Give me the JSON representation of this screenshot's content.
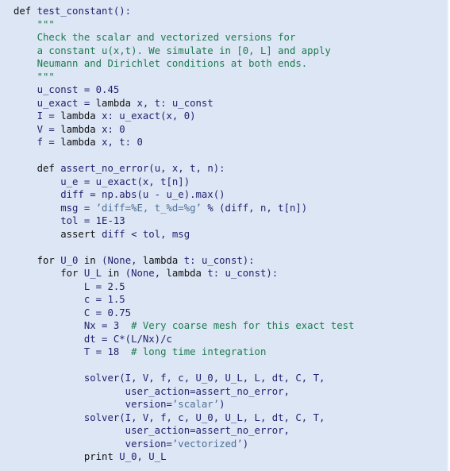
{
  "listing": {
    "language": "python",
    "colors": {
      "background": "#dce6f5",
      "keyword": "#111111",
      "identifier": "#22226e",
      "string": "#4d6f94",
      "comment": "#1e7a4e"
    },
    "lines": [
      [
        [
          "kw",
          "def "
        ],
        [
          "id",
          "test_constant():"
        ]
      ],
      [
        [
          "com",
          "    \"\"\""
        ]
      ],
      [
        [
          "com",
          "    Check the scalar and vectorized versions for"
        ]
      ],
      [
        [
          "com",
          "    a constant u(x,t). We simulate in [0, L] and apply"
        ]
      ],
      [
        [
          "com",
          "    Neumann and Dirichlet conditions at both ends."
        ]
      ],
      [
        [
          "com",
          "    \"\"\""
        ]
      ],
      [
        [
          "id",
          "    u_const = 0.45"
        ]
      ],
      [
        [
          "id",
          "    u_exact = "
        ],
        [
          "kw",
          "lambda "
        ],
        [
          "id",
          "x, t: u_const"
        ]
      ],
      [
        [
          "id",
          "    I = "
        ],
        [
          "kw",
          "lambda "
        ],
        [
          "id",
          "x: u_exact(x, 0)"
        ]
      ],
      [
        [
          "id",
          "    V = "
        ],
        [
          "kw",
          "lambda "
        ],
        [
          "id",
          "x: 0"
        ]
      ],
      [
        [
          "id",
          "    f = "
        ],
        [
          "kw",
          "lambda "
        ],
        [
          "id",
          "x, t: 0"
        ]
      ],
      [
        [
          "id",
          ""
        ]
      ],
      [
        [
          "kw",
          "    def "
        ],
        [
          "id",
          "assert_no_error(u, x, t, n):"
        ]
      ],
      [
        [
          "id",
          "        u_e = u_exact(x, t[n])"
        ]
      ],
      [
        [
          "id",
          "        diff = np.abs(u - u_e).max()"
        ]
      ],
      [
        [
          "id",
          "        msg = "
        ],
        [
          "str",
          "’diff=%E, t_%d=%g’"
        ],
        [
          "id",
          " % (diff, n, t[n])"
        ]
      ],
      [
        [
          "id",
          "        tol = 1E-13"
        ]
      ],
      [
        [
          "kw",
          "        assert "
        ],
        [
          "id",
          "diff < tol, msg"
        ]
      ],
      [
        [
          "id",
          ""
        ]
      ],
      [
        [
          "kw",
          "    for "
        ],
        [
          "id",
          "U_0 "
        ],
        [
          "kw",
          "in "
        ],
        [
          "id",
          "(None, "
        ],
        [
          "kw",
          "lambda "
        ],
        [
          "id",
          "t: u_const):"
        ]
      ],
      [
        [
          "kw",
          "        for "
        ],
        [
          "id",
          "U_L "
        ],
        [
          "kw",
          "in "
        ],
        [
          "id",
          "(None, "
        ],
        [
          "kw",
          "lambda "
        ],
        [
          "id",
          "t: u_const):"
        ]
      ],
      [
        [
          "id",
          "            L = 2.5"
        ]
      ],
      [
        [
          "id",
          "            c = 1.5"
        ]
      ],
      [
        [
          "id",
          "            C = 0.75"
        ]
      ],
      [
        [
          "id",
          "            Nx = 3  "
        ],
        [
          "com",
          "# Very coarse mesh for this exact test"
        ]
      ],
      [
        [
          "id",
          "            dt = C*(L/Nx)/c"
        ]
      ],
      [
        [
          "id",
          "            T = 18  "
        ],
        [
          "com",
          "# long time integration"
        ]
      ],
      [
        [
          "id",
          ""
        ]
      ],
      [
        [
          "id",
          "            solver(I, V, f, c, U_0, U_L, L, dt, C, T,"
        ]
      ],
      [
        [
          "id",
          "                   user_action=assert_no_error,"
        ]
      ],
      [
        [
          "id",
          "                   version="
        ],
        [
          "str",
          "’scalar’"
        ],
        [
          "id",
          ")"
        ]
      ],
      [
        [
          "id",
          "            solver(I, V, f, c, U_0, U_L, L, dt, C, T,"
        ]
      ],
      [
        [
          "id",
          "                   user_action=assert_no_error,"
        ]
      ],
      [
        [
          "id",
          "                   version="
        ],
        [
          "str",
          "’vectorized’"
        ],
        [
          "id",
          ")"
        ]
      ],
      [
        [
          "kw",
          "            print "
        ],
        [
          "id",
          "U_0, U_L"
        ]
      ]
    ]
  }
}
